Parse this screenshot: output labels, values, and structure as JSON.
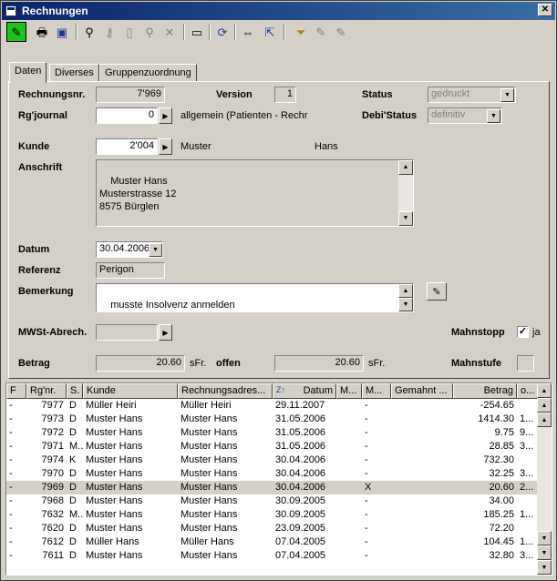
{
  "window": {
    "title": "Rechnungen"
  },
  "toolbar": {
    "icons": [
      "pencil-icon",
      "print-icon",
      "save-icon",
      "binoculars-icon",
      "key-icon",
      "new-doc-icon",
      "pin-icon",
      "delete-icon",
      "minimize-icon",
      "refresh-icon",
      "fit-width-icon",
      "fit-page-icon",
      "filter-icon",
      "edit-note-icon",
      "edit-note-2-icon"
    ]
  },
  "tabs": [
    {
      "label": "Daten"
    },
    {
      "label": "Diverses"
    },
    {
      "label": "Gruppenzuordnung"
    }
  ],
  "form": {
    "rechnungsnr_label": "Rechnungsnr.",
    "rechnungsnr_value": "7'969",
    "version_label": "Version",
    "version_value": "1",
    "status_label": "Status",
    "status_value": "gedruckt",
    "rgjournal_label": "Rg'journal",
    "rgjournal_value": "0",
    "rgjournal_text": "allgemein (Patienten - Rechr",
    "debistatus_label": "Debi'Status",
    "debistatus_value": "definitiv",
    "kunde_label": "Kunde",
    "kunde_value": "2'004",
    "kunde_name": "Muster",
    "kunde_vorname": "Hans",
    "anschrift_label": "Anschrift",
    "anschrift_value": "Muster Hans\nMusterstrasse 12\n8575 Bürglen",
    "datum_label": "Datum",
    "datum_value": "30.04.2006",
    "referenz_label": "Referenz",
    "referenz_value": "Perigon",
    "bemerkung_label": "Bemerkung",
    "bemerkung_value": "musste Insolvenz anmelden",
    "mwst_label": "MWSt-Abrech.",
    "mwst_value": "",
    "mahnstopp_label": "Mahnstopp",
    "mahnstopp_checked": "✓",
    "mahnstopp_text": "ja",
    "betrag_label": "Betrag",
    "betrag_value": "20.60",
    "betrag_currency": "sFr.",
    "offen_label": "offen",
    "offen_value": "20.60",
    "offen_currency": "sFr.",
    "mahnstufe_label": "Mahnstufe",
    "mahnstufe_value": ""
  },
  "grid": {
    "columns": [
      "F",
      "Rg'nr.",
      "S.",
      "Kunde",
      "Rechnungsadres...",
      "Datum",
      "M...",
      "M...",
      "Gemahnt ...",
      "Betrag",
      "o..."
    ],
    "rows": [
      [
        "-",
        "7977",
        "D",
        "Müller Heiri",
        "Müller Heiri",
        "29.11.2007",
        "",
        "-",
        "",
        "-254.65",
        ""
      ],
      [
        "-",
        "7973",
        "D",
        "Muster Hans",
        "Muster Hans",
        "31.05.2006",
        "",
        "-",
        "",
        "1414.30",
        "1..."
      ],
      [
        "-",
        "7972",
        "D",
        "Muster Hans",
        "Muster Hans",
        "31.05.2006",
        "",
        "-",
        "",
        "9.75",
        "9..."
      ],
      [
        "-",
        "7971",
        "M...",
        "Muster Hans",
        "Muster Hans",
        "31.05.2006",
        "",
        "-",
        "",
        "28.85",
        "3..."
      ],
      [
        "-",
        "7974",
        "K",
        "Muster Hans",
        "Muster Hans",
        "30.04.2006",
        "",
        "-",
        "",
        "732.30",
        ""
      ],
      [
        "-",
        "7970",
        "D",
        "Muster Hans",
        "Muster Hans",
        "30.04.2006",
        "",
        "-",
        "",
        "32.25",
        "3..."
      ],
      [
        "-",
        "7969",
        "D",
        "Muster Hans",
        "Muster Hans",
        "30.04.2006",
        "",
        "X",
        "",
        "20.60",
        "2..."
      ],
      [
        "-",
        "7968",
        "D",
        "Muster Hans",
        "Muster Hans",
        "30.09.2005",
        "",
        "-",
        "",
        "34.00",
        ""
      ],
      [
        "-",
        "7632",
        "M...",
        "Muster Hans",
        "Muster Hans",
        "30.09.2005",
        "",
        "-",
        "",
        "185.25",
        "1..."
      ],
      [
        "-",
        "7620",
        "D",
        "Muster Hans",
        "Muster Hans",
        "23.09.2005",
        "",
        "-",
        "",
        "72.20",
        ""
      ],
      [
        "-",
        "7612",
        "D",
        "Müller Hans",
        "Müller Hans",
        "07.04.2005",
        "",
        "-",
        "",
        "104.45",
        "1..."
      ],
      [
        "-",
        "7611",
        "D",
        "Muster Hans",
        "Muster Hans",
        "07.04.2005",
        "",
        "-",
        "",
        "32.80",
        "3..."
      ]
    ],
    "selected_row": 6
  }
}
